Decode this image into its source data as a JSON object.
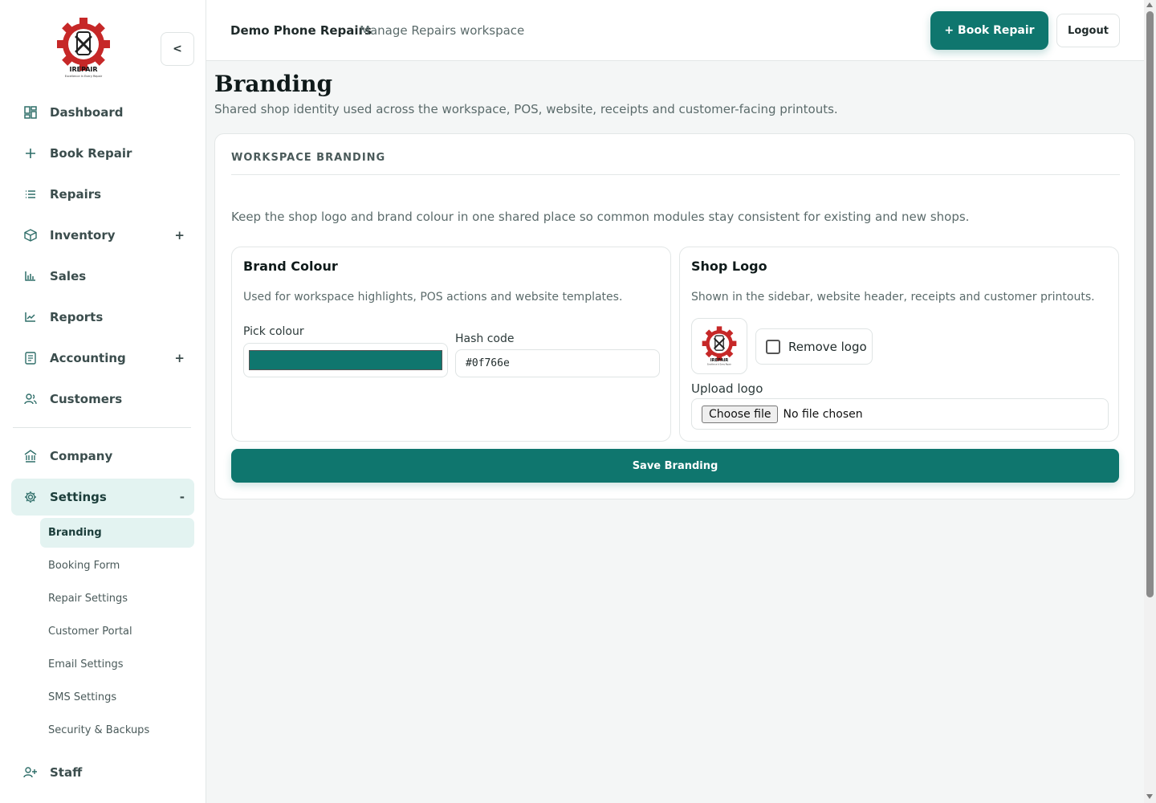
{
  "brand": {
    "logo_text": "IREPAIR",
    "logo_tagline": "Excellence In Every Repair",
    "accent": "#0f766e"
  },
  "sidebar": {
    "collapse_label": "<",
    "items": [
      {
        "label": "Dashboard",
        "icon": "dashboard-icon"
      },
      {
        "label": "Book Repair",
        "icon": "plus-icon"
      },
      {
        "label": "Repairs",
        "icon": "list-icon"
      },
      {
        "label": "Inventory",
        "icon": "box-icon",
        "toggle": "+"
      },
      {
        "label": "Sales",
        "icon": "bar-chart-icon"
      },
      {
        "label": "Reports",
        "icon": "line-chart-icon"
      },
      {
        "label": "Accounting",
        "icon": "ledger-icon",
        "toggle": "+"
      },
      {
        "label": "Customers",
        "icon": "users-icon"
      },
      {
        "label": "Company",
        "icon": "building-icon"
      },
      {
        "label": "Settings",
        "icon": "gear-icon",
        "toggle": "-"
      },
      {
        "label": "Staff",
        "icon": "user-plus-icon"
      }
    ],
    "settings_sub": [
      {
        "label": "Branding"
      },
      {
        "label": "Booking Form"
      },
      {
        "label": "Repair Settings"
      },
      {
        "label": "Customer Portal"
      },
      {
        "label": "Email Settings"
      },
      {
        "label": "SMS Settings"
      },
      {
        "label": "Security & Backups"
      }
    ]
  },
  "header": {
    "shop_name": "Demo Phone Repairs",
    "workspace": "Manage Repairs workspace",
    "book_repair": "+ Book Repair",
    "logout": "Logout"
  },
  "page": {
    "title": "Branding",
    "subtitle": "Shared shop identity used across the workspace, POS, website, receipts and customer-facing printouts."
  },
  "card": {
    "heading": "WORKSPACE BRANDING",
    "description": "Keep the shop logo and brand colour in one shared place so common modules stay consistent for existing and new shops.",
    "brand_colour": {
      "title": "Brand Colour",
      "description": "Used for workspace highlights, POS actions and website templates.",
      "pick_label": "Pick colour",
      "hash_label": "Hash code",
      "hash_value": "#0f766e"
    },
    "shop_logo": {
      "title": "Shop Logo",
      "description": "Shown in the sidebar, website header, receipts and customer printouts.",
      "remove_label": "Remove logo",
      "remove_checked": false,
      "upload_label": "Upload logo",
      "choose_file": "Choose file",
      "no_file": "No file chosen"
    },
    "save_label": "Save Branding"
  }
}
